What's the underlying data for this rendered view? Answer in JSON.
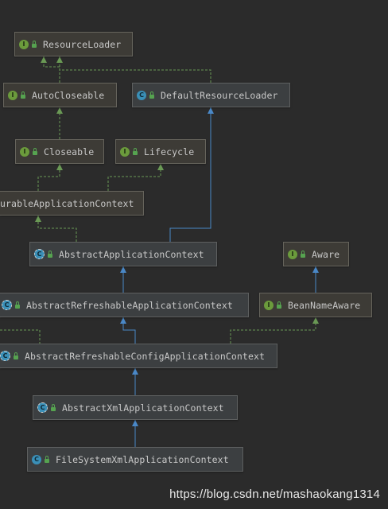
{
  "nodes": [
    {
      "id": "resource-loader",
      "label": "ResourceLoader",
      "kind": "interface"
    },
    {
      "id": "auto-closeable",
      "label": "AutoCloseable",
      "kind": "interface"
    },
    {
      "id": "default-resource-loader",
      "label": "DefaultResourceLoader",
      "kind": "class"
    },
    {
      "id": "closeable",
      "label": "Closeable",
      "kind": "interface"
    },
    {
      "id": "lifecycle",
      "label": "Lifecycle",
      "kind": "interface"
    },
    {
      "id": "configurable-application-context",
      "label": "urableApplicationContext",
      "kind": "interface"
    },
    {
      "id": "abstract-application-context",
      "label": "AbstractApplicationContext",
      "kind": "abstract"
    },
    {
      "id": "aware",
      "label": "Aware",
      "kind": "interface"
    },
    {
      "id": "abstract-refreshable-application-context",
      "label": "AbstractRefreshableApplicationContext",
      "kind": "abstract"
    },
    {
      "id": "bean-name-aware",
      "label": "BeanNameAware",
      "kind": "interface"
    },
    {
      "id": "abstract-refreshable-config-application-context",
      "label": "AbstractRefreshableConfigApplicationContext",
      "kind": "abstract"
    },
    {
      "id": "abstract-xml-application-context",
      "label": "AbstractXmlApplicationContext",
      "kind": "abstract"
    },
    {
      "id": "file-system-xml-application-context",
      "label": "FileSystemXmlApplicationContext",
      "kind": "class"
    }
  ],
  "edges": [
    {
      "from": "auto-closeable",
      "to": "resource-loader",
      "type": "implements"
    },
    {
      "from": "default-resource-loader",
      "to": "resource-loader",
      "type": "implements"
    },
    {
      "from": "closeable",
      "to": "auto-closeable",
      "type": "implements"
    },
    {
      "from": "configurable-application-context",
      "to": "closeable",
      "type": "implements"
    },
    {
      "from": "configurable-application-context",
      "to": "lifecycle",
      "type": "implements"
    },
    {
      "from": "abstract-application-context",
      "to": "configurable-application-context",
      "type": "implements"
    },
    {
      "from": "abstract-application-context",
      "to": "default-resource-loader",
      "type": "extends"
    },
    {
      "from": "abstract-refreshable-application-context",
      "to": "abstract-application-context",
      "type": "extends"
    },
    {
      "from": "bean-name-aware",
      "to": "aware",
      "type": "extends"
    },
    {
      "from": "abstract-refreshable-config-application-context",
      "to": "abstract-refreshable-application-context",
      "type": "extends"
    },
    {
      "from": "abstract-refreshable-config-application-context",
      "to": "bean-name-aware",
      "type": "implements"
    },
    {
      "from": "abstract-xml-application-context",
      "to": "abstract-refreshable-config-application-context",
      "type": "extends"
    },
    {
      "from": "file-system-xml-application-context",
      "to": "abstract-xml-application-context",
      "type": "extends"
    }
  ],
  "colors": {
    "extends": "#4a88c7",
    "implements": "#6a9955"
  },
  "watermark": "https://blog.csdn.net/mashaokang1314"
}
